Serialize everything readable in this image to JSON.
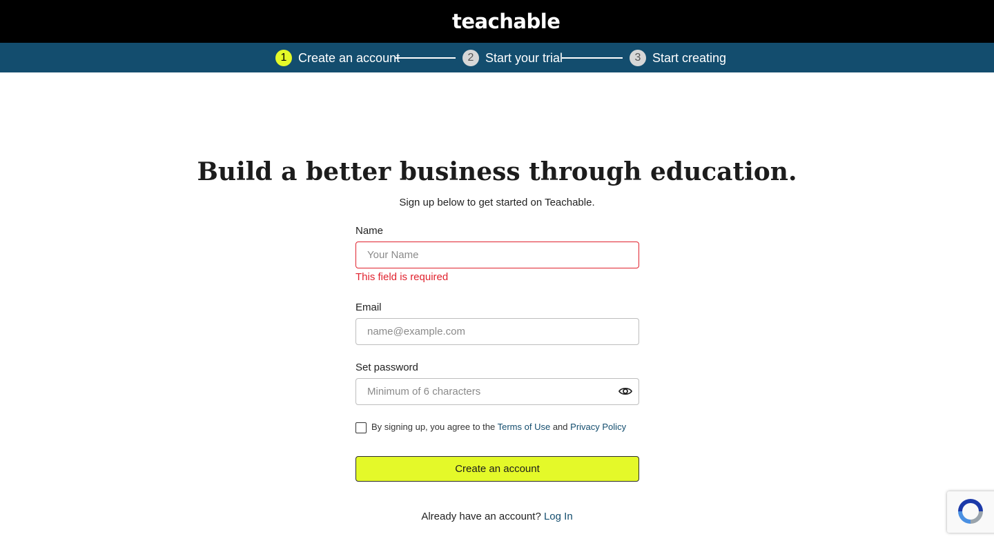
{
  "header": {
    "logo_text": "teachable"
  },
  "steps": [
    {
      "number": "1",
      "label": "Create an account",
      "state": "active"
    },
    {
      "number": "2",
      "label": "Start your trial",
      "state": "inactive"
    },
    {
      "number": "3",
      "label": "Start creating",
      "state": "inactive"
    }
  ],
  "main": {
    "headline": "Build a better business through education.",
    "subheadline": "Sign up below to get started on Teachable."
  },
  "form": {
    "name": {
      "label": "Name",
      "placeholder": "Your Name",
      "value": "",
      "error": "This field is required"
    },
    "email": {
      "label": "Email",
      "placeholder": "name@example.com",
      "value": ""
    },
    "password": {
      "label": "Set password",
      "placeholder": "Minimum of 6 characters",
      "value": ""
    },
    "terms": {
      "checked": false,
      "prefix": "By signing up, you agree to the",
      "terms_link": "Terms of Use",
      "and": "and",
      "privacy_link": "Privacy Policy"
    },
    "submit_label": "Create an account"
  },
  "footer": {
    "login_prompt": "Already have an account?",
    "login_link": "Log In"
  },
  "colors": {
    "accent": "#e4f929",
    "step_bar": "#134d6e",
    "error": "#e0212d"
  },
  "icons": {
    "password_toggle": "eye-icon",
    "recaptcha": "recaptcha-icon"
  }
}
